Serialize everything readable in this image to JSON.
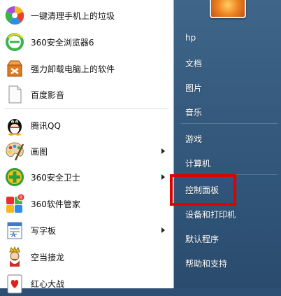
{
  "start_menu": {
    "programs": [
      {
        "label": "一键清理手机上的垃圾",
        "icon": "colorful-wheel-icon",
        "has_submenu": false
      },
      {
        "label": "360安全浏览器6",
        "icon": "360-browser-icon",
        "has_submenu": false
      },
      {
        "label": "强力卸载电脑上的软件",
        "icon": "uninstall-box-icon",
        "has_submenu": false
      },
      {
        "label": "百度影音",
        "icon": "document-icon",
        "has_submenu": false
      },
      {
        "label": "腾讯QQ",
        "icon": "qq-penguin-icon",
        "has_submenu": false
      },
      {
        "label": "画图",
        "icon": "paint-palette-icon",
        "has_submenu": true
      },
      {
        "label": "360安全卫士",
        "icon": "360-security-icon",
        "has_submenu": true
      },
      {
        "label": "360软件管家",
        "icon": "360-software-manager-icon",
        "has_submenu": false
      },
      {
        "label": "写字板",
        "icon": "wordpad-icon",
        "has_submenu": true
      },
      {
        "label": "空当接龙",
        "icon": "freecell-king-icon",
        "has_submenu": false
      },
      {
        "label": "红心大战",
        "icon": "hearts-card-icon",
        "has_submenu": false
      }
    ],
    "right_items": [
      {
        "label": "hp"
      },
      {
        "label": "文档"
      },
      {
        "label": "图片"
      },
      {
        "label": "音乐"
      },
      {
        "label": "游戏"
      },
      {
        "label": "计算机"
      },
      {
        "label": "控制面板"
      },
      {
        "label": "设备和打印机"
      },
      {
        "label": "默认程序"
      },
      {
        "label": "帮助和支持"
      }
    ],
    "highlighted_item": "控制面板",
    "colors": {
      "highlight_border": "#e00000",
      "right_pane": "#365b7f",
      "left_pane": "#ffffff"
    }
  }
}
